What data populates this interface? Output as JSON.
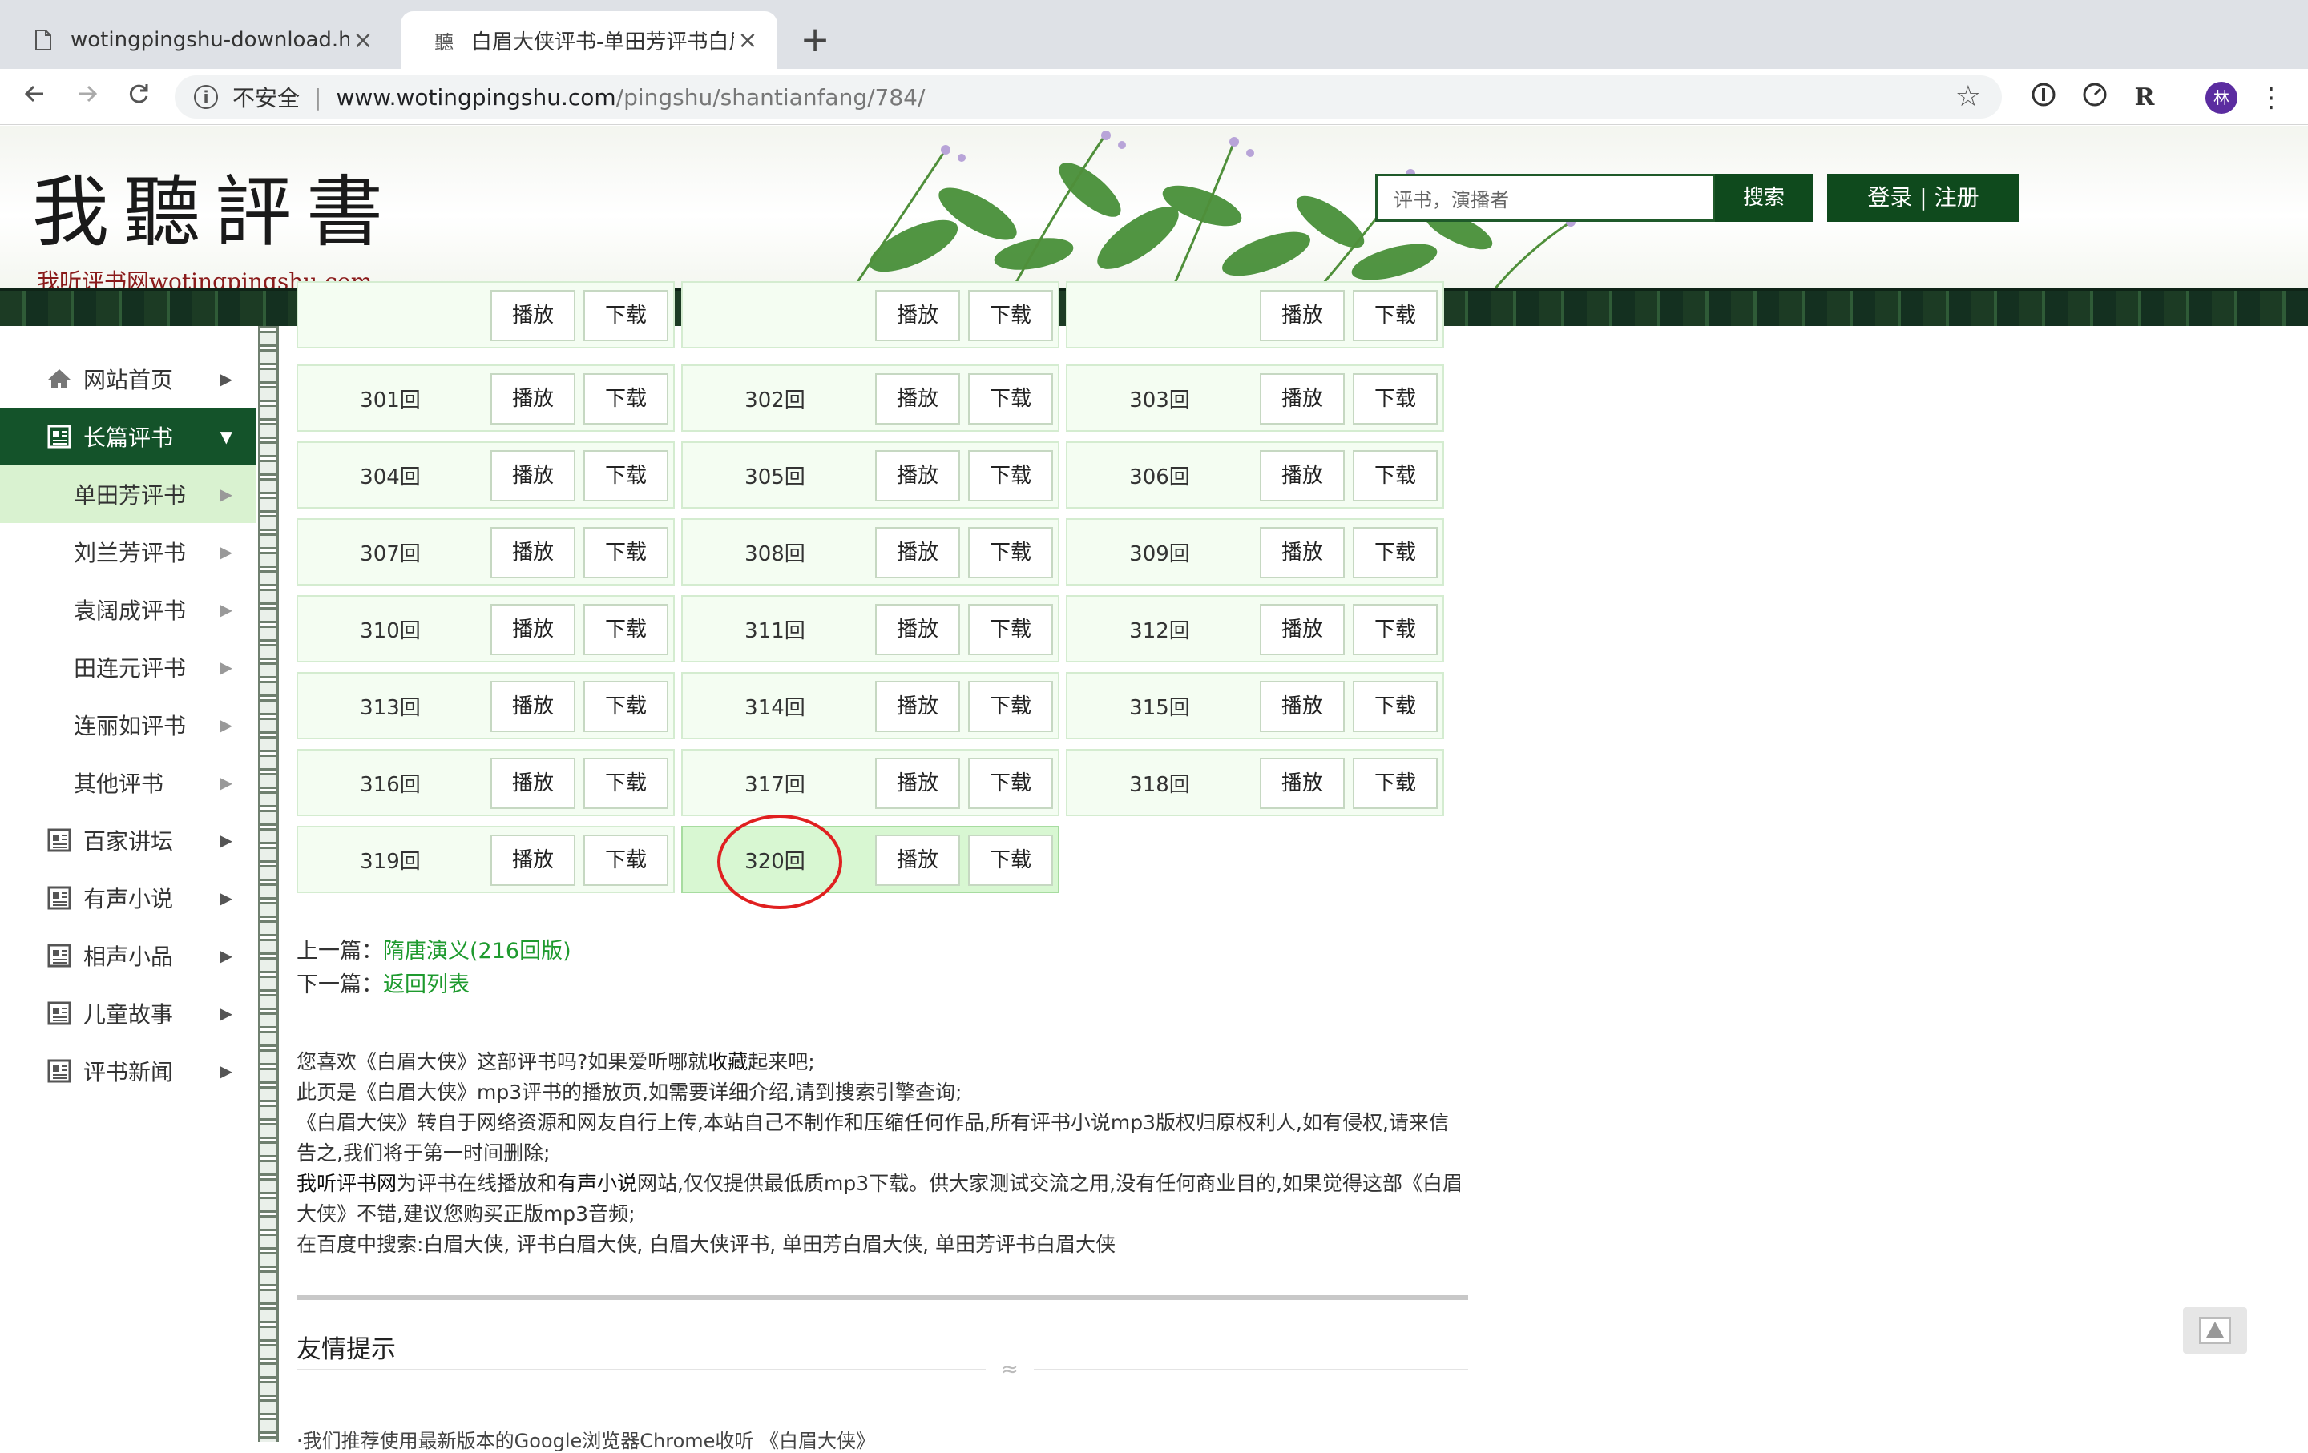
{
  "browser": {
    "tabs": [
      {
        "title": "wotingpingshu-download.html",
        "close": "×"
      },
      {
        "title": "白眉大侠评书-单田芳评书白眉大",
        "close": "×"
      }
    ],
    "new_tab": "+",
    "address": {
      "security": "不安全",
      "host": "www.wotingpingshu.com",
      "path": "/pingshu/shantianfang/784/"
    },
    "avatar": "林"
  },
  "header": {
    "logo_main": "我聽評書",
    "logo_sub": "我听评书网wotingpingshu.com",
    "search_placeholder": "评书，演播者",
    "search_button": "搜索",
    "auth_label": "登录 | 注册"
  },
  "sidebar": {
    "items": [
      {
        "label": "网站首页",
        "type": "home"
      },
      {
        "label": "长篇评书",
        "type": "open"
      },
      {
        "label": "单田芳评书",
        "type": "sub-selected"
      },
      {
        "label": "刘兰芳评书",
        "type": "sub"
      },
      {
        "label": "袁阔成评书",
        "type": "sub"
      },
      {
        "label": "田连元评书",
        "type": "sub"
      },
      {
        "label": "连丽如评书",
        "type": "sub"
      },
      {
        "label": "其他评书",
        "type": "sub"
      },
      {
        "label": "百家讲坛",
        "type": "doc"
      },
      {
        "label": "有声小说",
        "type": "doc"
      },
      {
        "label": "相声小品",
        "type": "doc"
      },
      {
        "label": "儿童故事",
        "type": "doc"
      },
      {
        "label": "评书新闻",
        "type": "doc"
      }
    ]
  },
  "episodes": {
    "play_label": "播放",
    "download_label": "下载",
    "list": [
      "301回",
      "302回",
      "303回",
      "304回",
      "305回",
      "306回",
      "307回",
      "308回",
      "309回",
      "310回",
      "311回",
      "312回",
      "313回",
      "314回",
      "315回",
      "316回",
      "317回",
      "318回",
      "319回",
      "320回"
    ],
    "current": "320回"
  },
  "prevnext": {
    "prev_label": "上一篇：",
    "prev_link": "隋唐演义(216回版)",
    "next_label": "下一篇：",
    "next_link": "返回列表"
  },
  "intro": {
    "line1a": "您喜欢《白眉大侠》这部评书吗?如果爱听哪就",
    "line1b": "收藏",
    "line1c": "起来吧;",
    "line2": "此页是《白眉大侠》mp3评书的播放页,如需要详细介绍,请到搜索引擎查询;",
    "line3": "《白眉大侠》转自于网络资源和网友自行上传,本站自己不制作和压缩任何作品,所有评书小说mp3版权归原权利人,如有侵权,请来信告之,我们将于第一时间删除;",
    "line4a": "我听评书网",
    "line4b": "为评书在线播放和",
    "line4c": "有声小说",
    "line4d": "网站,仅仅提供最低质mp3下载。供大家测试交流之用,没有任何商业目的,如果觉得这部《白眉大侠》不错,建议您购买正版mp3音频;",
    "line5": "在百度中搜索:白眉大侠, 评书白眉大侠, 白眉大侠评书, 单田芳白眉大侠, 单田芳评书白眉大侠"
  },
  "friendly": {
    "title": "友情提示",
    "first_line": "·我们推荐使用最新版本的Google浏览器Chrome收听 《白眉大侠》"
  }
}
